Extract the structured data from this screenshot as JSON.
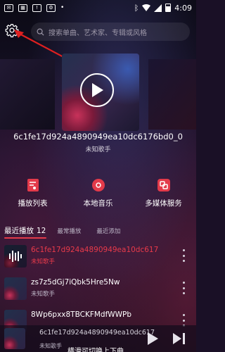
{
  "status_bar": {
    "time": "4:09"
  },
  "search": {
    "placeholder": "搜索单曲、艺术家、专辑或风格"
  },
  "featured": {
    "title": "6c1fe17d924a4890949ea10dc6176bd0_0",
    "artist": "未知歌手"
  },
  "quick_actions": [
    {
      "label": "播放列表",
      "icon": "playlist-icon"
    },
    {
      "label": "本地音乐",
      "icon": "disc-icon"
    },
    {
      "label": "多媒体服务",
      "icon": "media-service-icon"
    }
  ],
  "tabs": {
    "recent_label": "最近播放",
    "recent_count": "12",
    "favorites_label": "最常播放",
    "added_label": "最近添加"
  },
  "songs": [
    {
      "title": "6c1fe17d924a4890949ea10dc617",
      "artist": "未知歌手"
    },
    {
      "title": "zs7z5dGj7iQbk5Hre5Nw",
      "artist": "未知歌手"
    },
    {
      "title": "8Wp6pxx8TBCKFMdfWWPb",
      "artist": ""
    }
  ],
  "player": {
    "title": "6c1fe17d924a4890949ea10dc617",
    "artist": "未知歌手",
    "hint": "横滑可切换上下曲"
  },
  "colors": {
    "accent": "#e33a4a",
    "annotation_arrow": "#e02020"
  }
}
